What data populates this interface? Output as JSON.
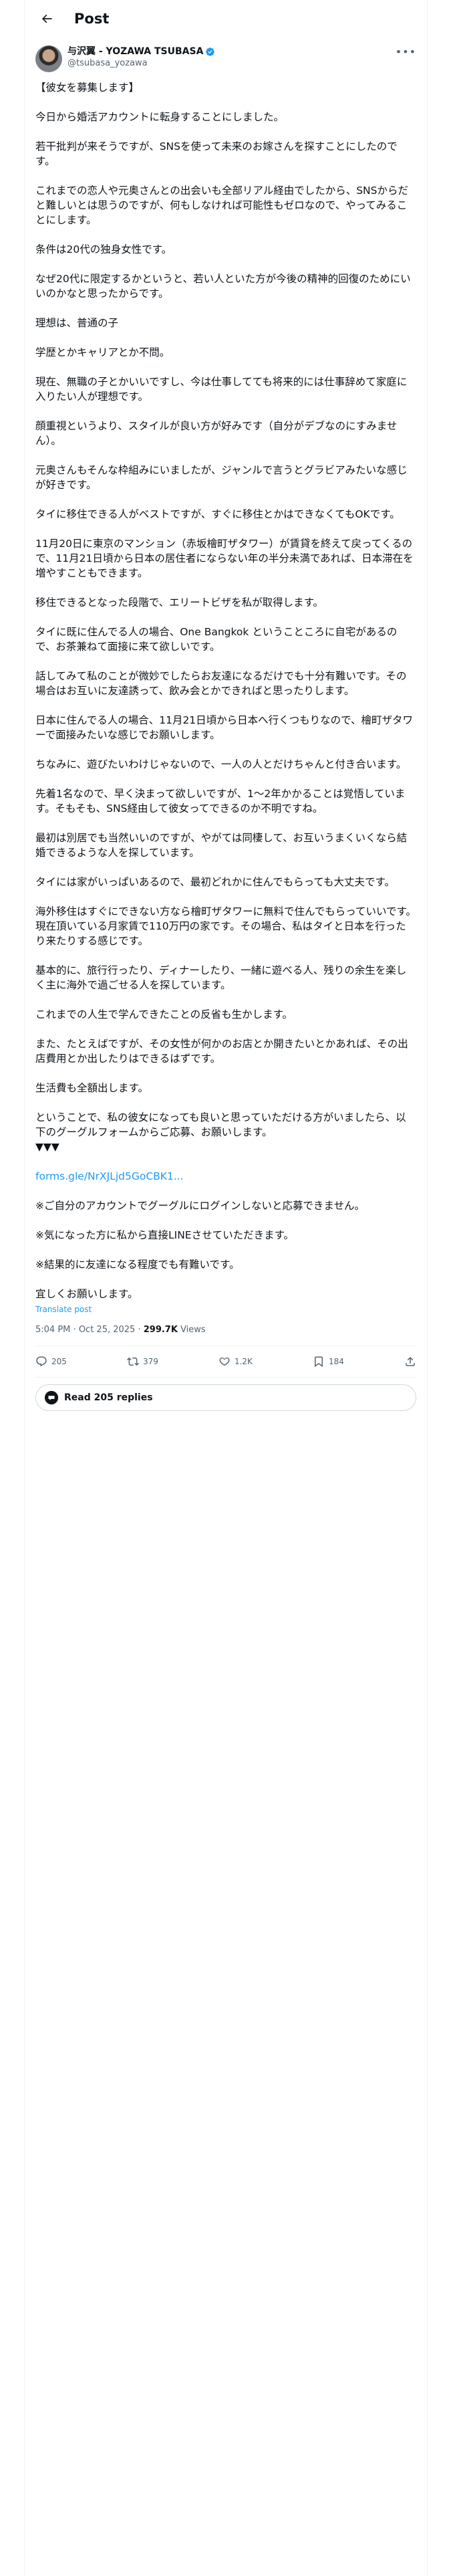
{
  "header": {
    "title": "Post"
  },
  "author": {
    "name": "与沢翼 - YOZAWA TSUBASA",
    "handle": "@tsubasa_yozawa"
  },
  "post": {
    "paragraphs": [
      "【彼女を募集します】",
      "今日から婚活アカウントに転身することにしました。",
      "若干批判が来そうですが、SNSを使って未来のお嫁さんを探すことにしたのです。",
      "これまでの恋人や元奥さんとの出会いも全部リアル経由でしたから、SNSからだと難しいとは思うのですが、何もしなければ可能性もゼロなので、やってみることにします。",
      "条件は20代の独身女性です。",
      "なぜ20代に限定するかというと、若い人といた方が今後の精神的回復のためにいいのかなと思ったからです。",
      "理想は、普通の子",
      "学歴とかキャリアとか不問。",
      "現在、無職の子とかいいですし、今は仕事してても将来的には仕事辞めて家庭に入りたい人が理想です。",
      "顔重視というより、スタイルが良い方が好みです（自分がデブなのにすみません）。",
      "元奥さんもそんな枠組みにいましたが、ジャンルで言うとグラビアみたいな感じが好きです。",
      "タイに移住できる人がベストですが、すぐに移住とかはできなくてもOKです。",
      "11月20日に東京のマンション（赤坂檜町ザタワー）が賃貸を終えて戻ってくるので、11月21日頃から日本の居住者にならない年の半分未満であれば、日本滞在を増やすこともできます。",
      "移住できるとなった段階で、エリートビザを私が取得します。",
      "タイに既に住んでる人の場合、One Bangkok ということころに自宅があるので、お茶兼ねて面接に来て欲しいです。",
      "話してみて私のことが微妙でしたらお友達になるだけでも十分有難いです。その場合はお互いに友達誘って、飲み会とかできればと思ったりします。",
      "日本に住んでる人の場合、11月21日頃から日本へ行くつもりなので、檜町ザタワーで面接みたいな感じでお願いします。",
      "ちなみに、遊びたいわけじゃないので、一人の人とだけちゃんと付き合います。",
      "先着1名なので、早く決まって欲しいですが、1〜2年かかることは覚悟しています。そもそも、SNS経由して彼女ってできるのか不明ですね。",
      "最初は別居でも当然いいのですが、やがては同棲して、お互いうまくいくなら結婚できるような人を探しています。",
      "タイには家がいっぱいあるので、最初どれかに住んでもらっても大丈夫です。",
      "海外移住はすぐにできない方なら檜町ザタワーに無料で住んでもらっていいです。現在頂いている月家賃で110万円の家です。その場合、私はタイと日本を行ったり来たりする感じです。",
      "基本的に、旅行行ったり、ディナーしたり、一緒に遊べる人、残りの余生を楽しく主に海外で過ごせる人を探しています。",
      "これまでの人生で学んできたことの反省も生かします。",
      "また、たとえばですが、その女性が何かのお店とか開きたいとかあれば、その出店費用とか出したりはできるはずです。",
      "生活費も全額出します。",
      "ということで、私の彼女になっても良いと思っていただける方がいましたら、以下のグーグルフォームからご応募、お願いします。\n▼▼▼"
    ],
    "link": "forms.gle/NrXJLjd5GoCBK1...",
    "notes": [
      "※ご自分のアカウントでグーグルにログインしないと応募できません。",
      "※気になった方に私から直接LINEさせていただきます。",
      "※結果的に友達になる程度でも有難いです。",
      "宜しくお願いします。"
    ],
    "translate": "Translate post"
  },
  "meta": {
    "time": "5:04 PM",
    "date": "Oct 25, 2025",
    "separator": "·",
    "views": "299.7K",
    "views_label": "Views"
  },
  "actions": {
    "replies": "205",
    "reposts": "379",
    "likes": "1.2K",
    "bookmarks": "184"
  },
  "replies_button": "Read 205 replies",
  "colors": {
    "link": "#1d9bf0",
    "secondary": "#536471",
    "border": "#eff3f4",
    "verified": "#1d9bf0"
  },
  "icons": [
    "back-arrow-icon",
    "verified-badge-icon",
    "more-icon",
    "reply-icon",
    "repost-icon",
    "like-icon",
    "bookmark-icon",
    "share-icon",
    "chat-bubble-icon"
  ]
}
